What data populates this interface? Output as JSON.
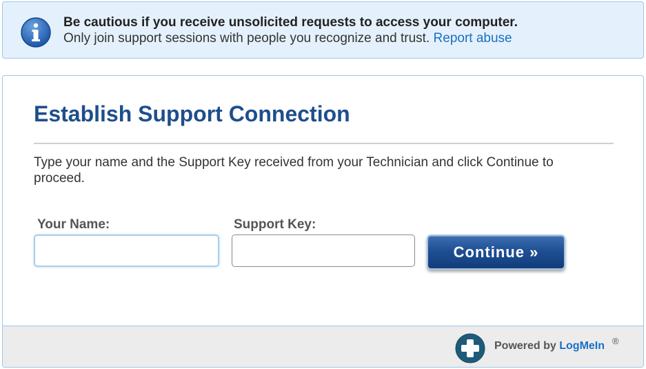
{
  "warning": {
    "title": "Be cautious if you receive unsolicited requests to access your computer.",
    "body": "Only join support sessions with people you recognize and trust.",
    "link": "Report abuse",
    "icon": "info-icon"
  },
  "panel": {
    "title": "Establish Support Connection",
    "instructions": "Type your name and the Support Key received from your Technician and click Continue to proceed.",
    "name_label": "Your Name:",
    "name_value": "",
    "key_label": "Support Key:",
    "key_value": "",
    "continue_label": "Continue »"
  },
  "footer": {
    "powered_by": "Powered by ",
    "brand": "LogMeIn",
    "registered": "®",
    "icon": "logmein-plus-logo"
  },
  "colors": {
    "accent": "#1e4e8c",
    "link": "#1a6fc4",
    "warning_bg": "#e4f1fc",
    "button": "#1f4f95"
  }
}
